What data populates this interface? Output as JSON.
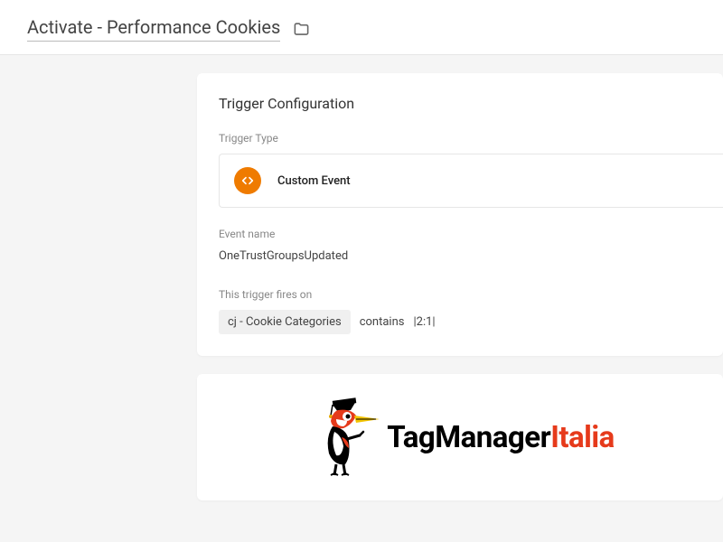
{
  "header": {
    "title": "Activate - Performance Cookies"
  },
  "config": {
    "card_title": "Trigger Configuration",
    "trigger_type_label": "Trigger Type",
    "trigger_type_name": "Custom Event",
    "event_name_label": "Event name",
    "event_name_value": "OneTrustGroupsUpdated",
    "fires_on_label": "This trigger fires on",
    "condition": {
      "variable": "cj - Cookie Categories",
      "operator": "contains",
      "value": "|2:1|"
    }
  },
  "logo": {
    "text_main": "TagManager",
    "text_accent": "Italia"
  }
}
